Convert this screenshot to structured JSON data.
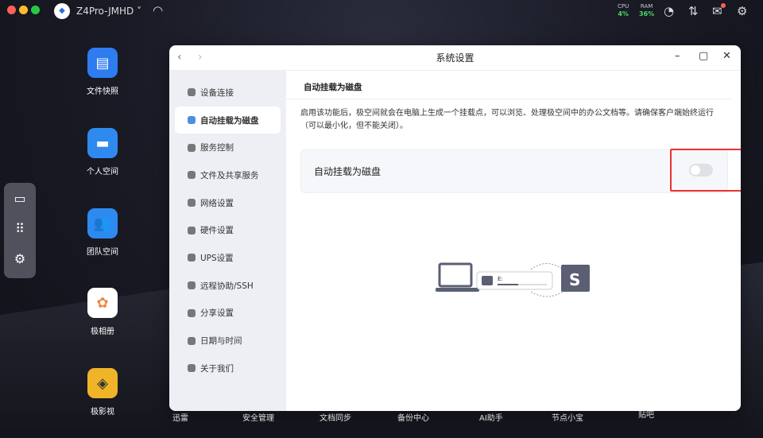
{
  "topbar": {
    "device_name": "Z4Pro-JMHD ˅",
    "cpu_label": "CPU",
    "cpu_value": "4%",
    "ram_label": "RAM",
    "ram_value": "36%"
  },
  "desktop": {
    "apps": [
      "文件快照",
      "个人空间",
      "团队空间",
      "极相册",
      "极影视"
    ],
    "bottom": [
      "迅雷",
      "安全管理",
      "文档同步",
      "备份中心",
      "AI助手",
      "节点小宝",
      "贴吧"
    ]
  },
  "window": {
    "title": "系统设置",
    "back": "‹",
    "forward": "›",
    "minimize": "–",
    "maximize": "▢",
    "close": "✕"
  },
  "sidebar": {
    "items": [
      "设备连接",
      "自动挂载为磁盘",
      "服务控制",
      "文件及共享服务",
      "网络设置",
      "硬件设置",
      "UPS设置",
      "远程协助/SSH",
      "分享设置",
      "日期与时间",
      "关于我们"
    ],
    "active": 1
  },
  "main": {
    "title": "自动挂载为磁盘",
    "description": "启用该功能后，极空间就会在电脑上生成一个挂载点，可以浏览、处理极空间中的办公文档等。请确保客户端始终运行（可以最小化，但不能关闭）。",
    "setting_label": "自动挂载为磁盘",
    "toggle_on": false,
    "drive_label": "E:"
  }
}
